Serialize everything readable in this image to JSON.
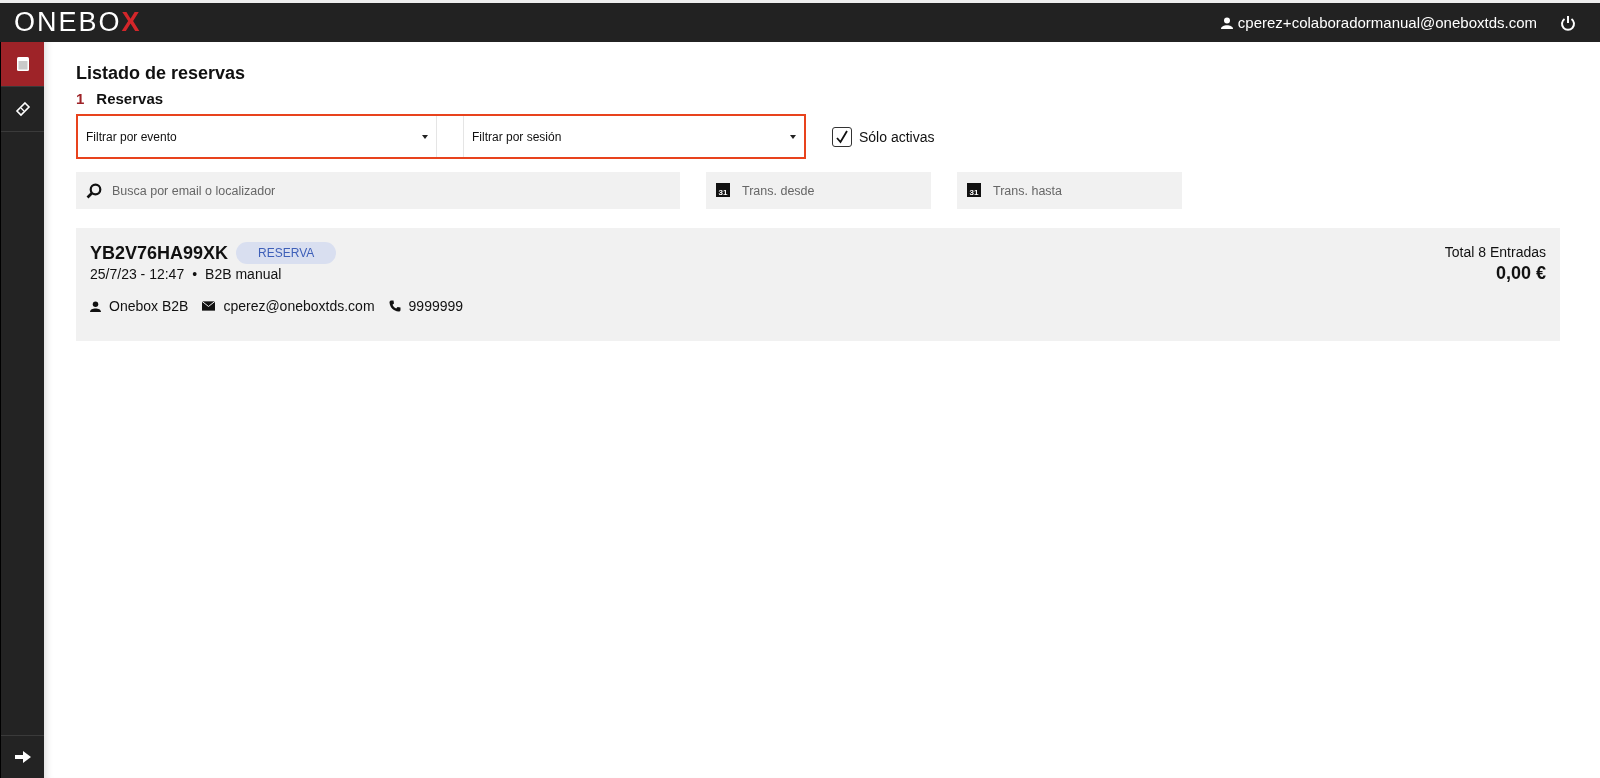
{
  "header": {
    "logo": {
      "text": "ONEBO",
      "accent": "X"
    },
    "user_email": "cperez+colaboradormanual@oneboxtds.com"
  },
  "sidebar": {
    "items": [
      {
        "kind": "bookings",
        "selected": true
      },
      {
        "kind": "tickets",
        "selected": false
      }
    ]
  },
  "page": {
    "title": "Listado de reservas",
    "count": "1",
    "count_label": "Reservas"
  },
  "filters": {
    "event": {
      "placeholder": "Filtrar por evento"
    },
    "session": {
      "placeholder": "Filtrar por sesión"
    },
    "only_active": {
      "label": "Sólo activas",
      "checked": true
    },
    "search": {
      "placeholder": "Busca por email o localizador"
    },
    "date_from": {
      "placeholder": "Trans. desde",
      "icon_text": "31"
    },
    "date_to": {
      "placeholder": "Trans. hasta",
      "icon_text": "31"
    }
  },
  "bookings": [
    {
      "locator": "YB2V76HA99XK",
      "badge": "RESERVA",
      "date": "25/7/23 - 12:47",
      "separator": "•",
      "channel": "B2B manual",
      "client": "Onebox B2B",
      "email": "cperez@oneboxtds.com",
      "phone": "9999999",
      "total_label": "Total 8 Entradas",
      "total": "0,00 €"
    }
  ]
}
